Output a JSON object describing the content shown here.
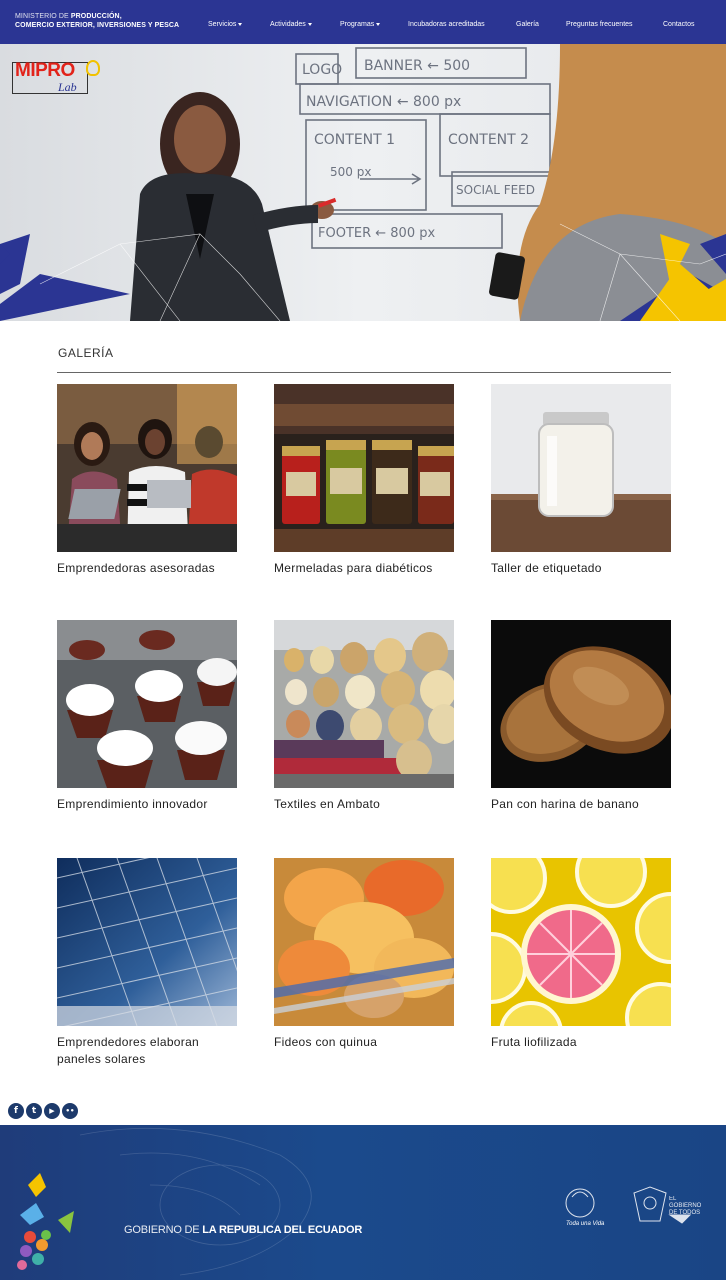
{
  "header": {
    "ministry_line1_thin": "MINISTERIO DE",
    "ministry_line1_bold": "PRODUCCIÓN,",
    "ministry_line2": "COMERCIO EXTERIOR, INVERSIONES Y PESCA",
    "nav": [
      {
        "label": "Servicios",
        "dropdown": true
      },
      {
        "label": "Actividades",
        "dropdown": true
      },
      {
        "label": "Programas",
        "dropdown": true
      },
      {
        "label": "Incubadoras acreditadas",
        "dropdown": false
      },
      {
        "label": "Galería",
        "dropdown": false
      },
      {
        "label": "Preguntas frecuentes",
        "dropdown": false
      },
      {
        "label": "Contactos",
        "dropdown": false
      }
    ]
  },
  "hero": {
    "logo_text": "MIPRO",
    "logo_sub": "Lab",
    "whiteboard": [
      "LOGO",
      "BANNER ← 500",
      "NAVIGATION ← 800 px",
      "CONTENT 1",
      "CONTENT 2",
      "500 px",
      "SOCIAL FEED",
      "FOOTER ← 800 px"
    ]
  },
  "gallery": {
    "title": "GALERÍA",
    "items": [
      {
        "caption": "Emprendedoras asesoradas"
      },
      {
        "caption": "Mermeladas para diabéticos"
      },
      {
        "caption": "Taller de etiquetado"
      },
      {
        "caption": "Emprendimiento innovador"
      },
      {
        "caption": "Textiles en Ambato"
      },
      {
        "caption": "Pan con harina de banano"
      },
      {
        "caption": "Emprendedores elaboran paneles solares"
      },
      {
        "caption": "Fideos con quinua"
      },
      {
        "caption": "Fruta liofilizada"
      }
    ]
  },
  "social": [
    {
      "icon": "facebook-icon",
      "glyph": "f"
    },
    {
      "icon": "twitter-icon",
      "glyph": "t"
    },
    {
      "icon": "youtube-icon",
      "glyph": "▶"
    },
    {
      "icon": "flickr-icon",
      "glyph": "••"
    }
  ],
  "footer": {
    "gov_thin": "GOBIERNO DE ",
    "gov_bold": "LA REPUBLICA DEL ECUADOR",
    "logo_1": "Toda una Vida",
    "logo_2_line1": "EL",
    "logo_2_line2": "GOBIERNO",
    "logo_2_line3": "DE TODOS"
  },
  "colors": {
    "nav_bg": "#2b3593",
    "footer_bg": "#1f3c7a",
    "accent_yellow": "#f5c400",
    "logo_red": "#e2231a"
  }
}
